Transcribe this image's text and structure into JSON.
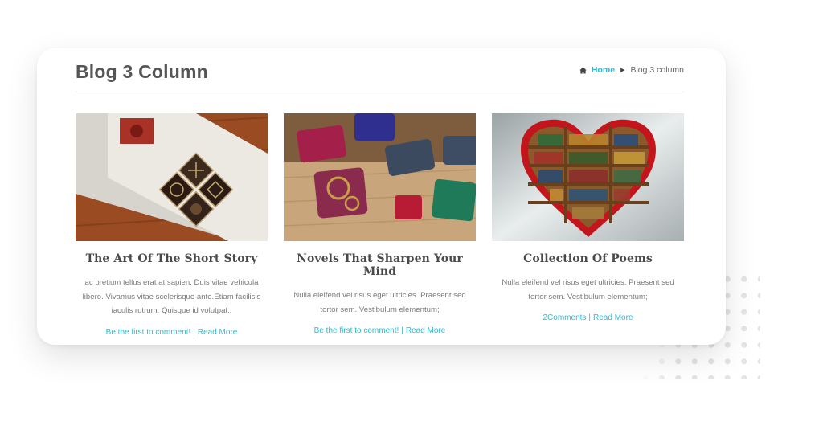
{
  "header": {
    "title": "Blog 3 Column",
    "breadcrumb": {
      "home": "Home",
      "current": "Blog 3 column"
    }
  },
  "posts": [
    {
      "title": "The Art Of The Short Story",
      "excerpt": "ac pretium tellus erat at sapien. Duis vitae vehicula libero. Vivamus vitae scelerisque ante.Etiam facilisis iaculis rutrum. Quisque id volutpat..",
      "comments": "Be the first to comment!",
      "read_more": "Read More"
    },
    {
      "title": "Novels That Sharpen Your Mind",
      "excerpt": "Nulla eleifend vel risus eget ultricies. Praesent sed tortor sem. Vestibulum elementum;",
      "comments": "Be the first to comment!",
      "read_more": "Read More"
    },
    {
      "title": "Collection Of Poems",
      "excerpt": "Nulla eleifend vel risus eget ultricies. Praesent sed tortor sem. Vestibulum elementum;",
      "comments": "2Comments",
      "read_more": "Read More"
    }
  ],
  "meta_separator": "|",
  "colors": {
    "accent": "#2bbbd0",
    "heading": "#555555",
    "text": "#7a7a7a"
  }
}
